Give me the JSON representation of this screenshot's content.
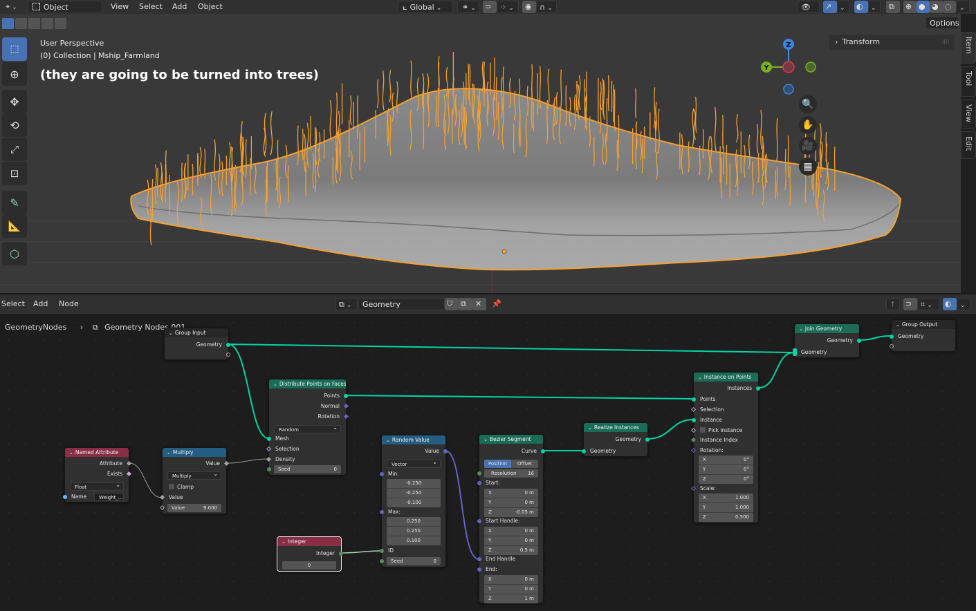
{
  "viewport_header": {
    "editor_type_icon": "3d-viewport-icon",
    "mode": "Object Mode",
    "menus": [
      "View",
      "Select",
      "Add",
      "Object"
    ],
    "transform_orientation": "Global",
    "pivot_icon": "pivot-link-icon",
    "snap_icon": "magnet-snap-icon",
    "snap_target_icon": "snap-grid-icon",
    "proportional_icon": "proportional-edit-icon",
    "falloff_icon": "falloff-curve-icon",
    "visibility_icon": "eye-visibility-icon",
    "gizmo_icon": "gizmo-arrow-icon",
    "overlay_icon": "overlay-icon",
    "xray_icon": "xray-icon",
    "shading_modes": [
      "wireframe",
      "solid",
      "material-preview",
      "rendered"
    ],
    "active_shading": "solid",
    "options_label": "Options"
  },
  "viewport": {
    "perspective_label": "User Perspective",
    "collection_label": "(0) Collection | Mship_Farmland",
    "annotation": "(they are going to be turned into trees)",
    "transform_panel_label": "Transform",
    "side_tabs": [
      "Item",
      "Tool",
      "View",
      "Edit"
    ],
    "active_side_tab": "Item",
    "gizmo_axes": {
      "z": "Z",
      "y": "Y"
    },
    "tools": [
      "select-box",
      "cursor",
      "move",
      "rotate",
      "scale",
      "transform",
      "annotate",
      "measure",
      "add-cube"
    ],
    "active_tool": "select-box",
    "colors": {
      "selection": "#f5a030",
      "mesh": "#9a9a9a",
      "background": "#393939"
    }
  },
  "node_editor": {
    "menus": [
      "Select",
      "Add",
      "Node"
    ],
    "node_tree_name": "Geometry Nodes.001",
    "breadcrumb": [
      "GeometryNodes",
      "Geometry Nodes.001"
    ],
    "nodes": {
      "group_input": {
        "title": "Group Input",
        "outputs": [
          "Geometry"
        ]
      },
      "group_output": {
        "title": "Group Output",
        "inputs": [
          "Geometry"
        ]
      },
      "join_geometry": {
        "title": "Join Geometry",
        "output": "Geometry",
        "input": "Geometry"
      },
      "distribute": {
        "title": "Distribute Points on Faces",
        "outputs": [
          "Points",
          "Normal",
          "Rotation"
        ],
        "mode": "Random",
        "inputs": [
          "Mesh",
          "Selection",
          "Density"
        ],
        "seed_label": "Seed",
        "seed_value": "0"
      },
      "named_attribute": {
        "title": "Named Attribute",
        "outputs": [
          "Attribute",
          "Exists"
        ],
        "type": "Float",
        "name_label": "Name",
        "name_value": "Weight_..."
      },
      "multiply": {
        "title": "Multiply",
        "output": "Value",
        "operation": "Multiply",
        "clamp_label": "Clamp",
        "clamp_checked": false,
        "input1": "Value",
        "value_label": "Value",
        "value": "9.000"
      },
      "random_value": {
        "title": "Random Value",
        "output": "Value",
        "data_type": "Vector",
        "min_label": "Min:",
        "min": [
          "-0.250",
          "-0.250",
          "-0.100"
        ],
        "max_label": "Max:",
        "max": [
          "0.250",
          "0.250",
          "0.100"
        ],
        "id_label": "ID",
        "seed_label": "Seed",
        "seed_value": "0"
      },
      "integer": {
        "title": "Integer",
        "output": "Integer",
        "value": "0"
      },
      "bezier_segment": {
        "title": "Bezier Segment",
        "output": "Curve",
        "modes": [
          "Position",
          "Offset"
        ],
        "active_mode": "Position",
        "resolution_label": "Resolution",
        "resolution": "16",
        "start_label": "Start:",
        "start": [
          [
            "X",
            "0 m"
          ],
          [
            "Y",
            "0 m"
          ],
          [
            "Z",
            "-0.05 m"
          ]
        ],
        "start_handle_label": "Start Handle:",
        "start_handle": [
          [
            "X",
            "0 m"
          ],
          [
            "Y",
            "0 m"
          ],
          [
            "Z",
            "0.5 m"
          ]
        ],
        "end_handle_label": "End Handle",
        "end_label": "End:",
        "end": [
          [
            "X",
            "0 m"
          ],
          [
            "Y",
            "0 m"
          ],
          [
            "Z",
            "1 m"
          ]
        ]
      },
      "realize_instances": {
        "title": "Realize Instances",
        "output": "Geometry",
        "input": "Geometry"
      },
      "instance_on_points": {
        "title": "Instance on Points",
        "output": "Instances",
        "inputs": [
          "Points",
          "Selection",
          "Instance"
        ],
        "pick_instance_label": "Pick Instance",
        "pick_instance_checked": false,
        "instance_index_label": "Instance Index",
        "rotation_label": "Rotation:",
        "rotation": [
          [
            "X",
            "0°"
          ],
          [
            "Y",
            "0°"
          ],
          [
            "Z",
            "0°"
          ]
        ],
        "scale_label": "Scale:",
        "scale": [
          [
            "X",
            "1.000"
          ],
          [
            "Y",
            "1.000"
          ],
          [
            "Z",
            "0.500"
          ]
        ]
      }
    },
    "colors": {
      "geometry_socket": "#00d6a3",
      "vector_socket": "#6363c7",
      "integer_socket": "#598c5c",
      "float_socket": "#a1a1a1",
      "geo_header": "#1b6c57",
      "input_header": "#8a2d47",
      "math_header": "#245d80"
    }
  }
}
